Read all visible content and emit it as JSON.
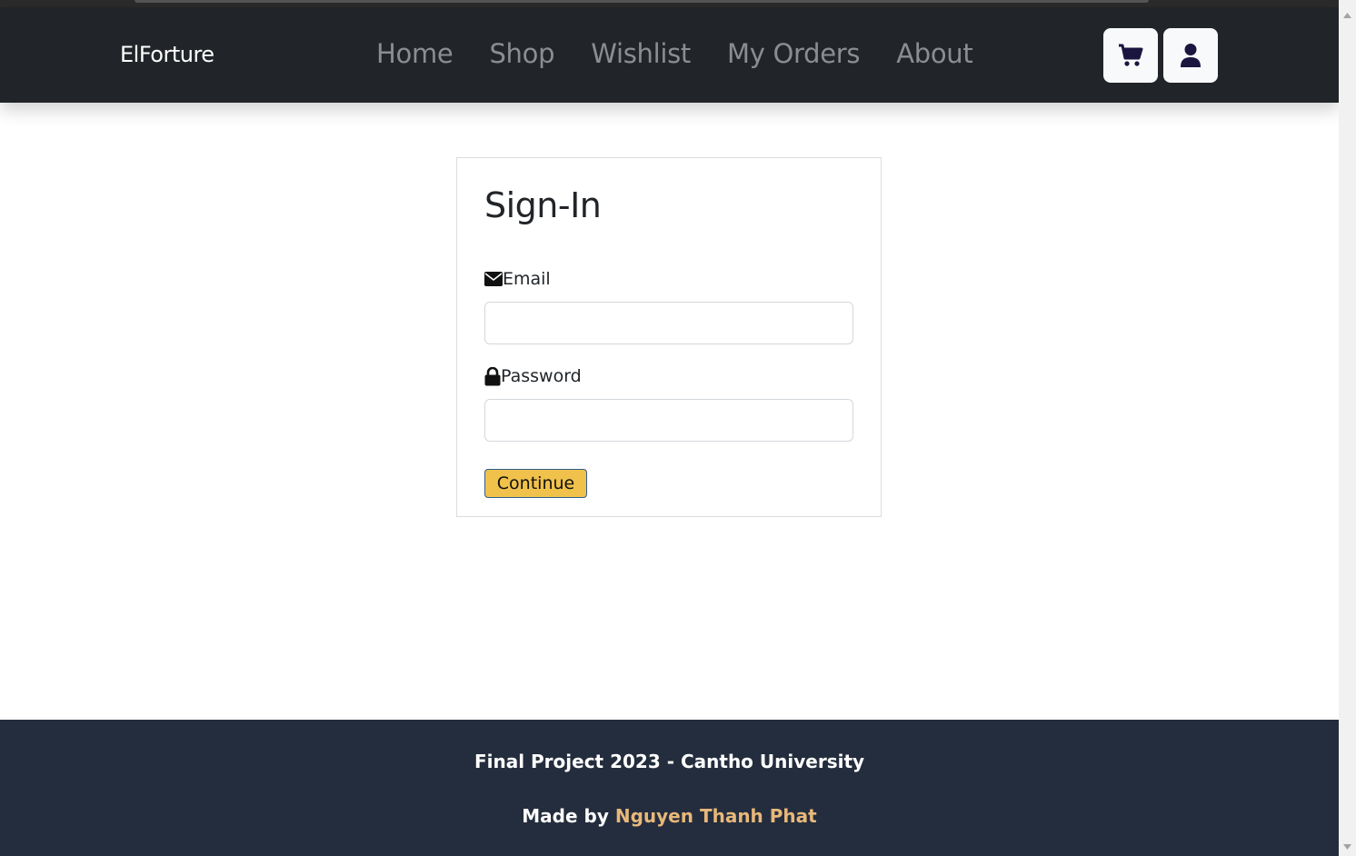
{
  "navbar": {
    "brand": "ElForture",
    "links": [
      "Home",
      "Shop",
      "Wishlist",
      "My Orders",
      "About"
    ],
    "cart_icon": "cart-icon",
    "user_icon": "user-icon",
    "icon_color": "#1a1640"
  },
  "signin": {
    "title": "Sign-In",
    "email_label": "Email",
    "email_icon": "envelope-icon",
    "email_value": "",
    "password_label": "Password",
    "password_icon": "lock-icon",
    "password_value": "",
    "continue_label": "Continue",
    "continue_color": "#f0c14b"
  },
  "footer": {
    "line1": "Final Project 2023 - Cantho University",
    "made_by": "Made by",
    "author": "Nguyen Thanh Phat",
    "author_color": "#e8b87a",
    "background": "#242d3d"
  }
}
